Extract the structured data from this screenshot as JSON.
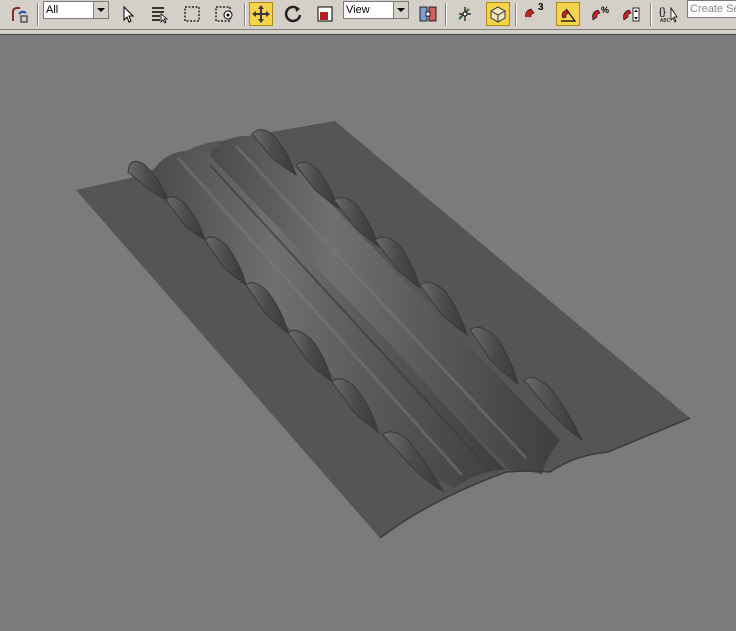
{
  "toolbar": {
    "selection_filter": "All",
    "reference_coordinate_system": "View",
    "snap_toggle_superscript": "3",
    "named_selection_placeholder": "Create Se"
  },
  "icons": [
    "select-and-link-icon",
    "selection-filter-dropdown",
    "select-object-icon",
    "select-by-name-icon",
    "rectangular-selection-region-icon",
    "window-crossing-icon",
    "select-and-move-icon",
    "select-and-rotate-icon",
    "select-and-scale-icon",
    "reference-coordinate-dropdown",
    "use-pivot-point-center-icon",
    "select-and-manipulate-icon",
    "keyboard-shortcut-override-icon",
    "snaps-toggle-icon",
    "angle-snap-toggle-icon",
    "percent-snap-toggle-icon",
    "spinner-snap-toggle-icon",
    "edit-named-selection-sets-icon"
  ],
  "colors": {
    "toolbar_bg": "#d4d0c8",
    "active_button": "#f6d34c",
    "viewport_bg": "#7b7b7b",
    "surface": "#555555"
  }
}
